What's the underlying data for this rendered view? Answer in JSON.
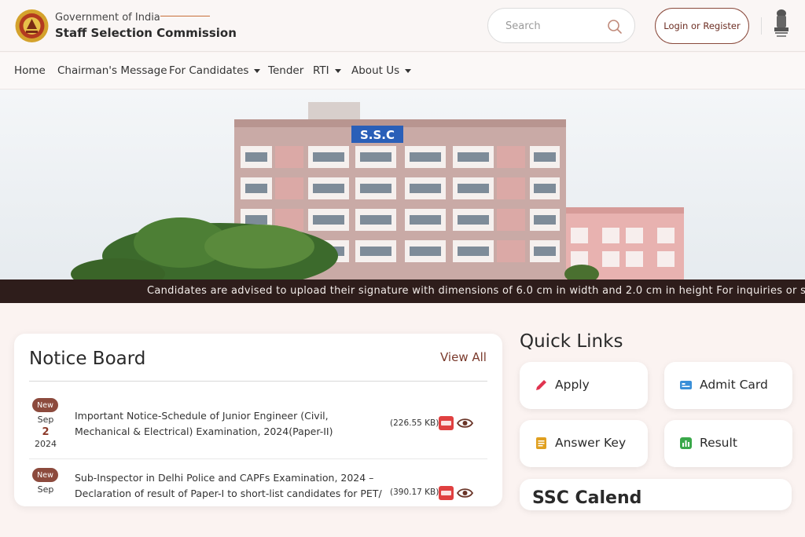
{
  "header": {
    "gov_label": "Government of India",
    "org_name": "Staff Selection Commission",
    "search_placeholder": "Search",
    "login_label": "Login or Register"
  },
  "nav": {
    "items": [
      {
        "label": "Home"
      },
      {
        "label": "Chairman's Message"
      },
      {
        "label": "For Candidates"
      },
      {
        "label": "Tender"
      },
      {
        "label": "RTI"
      },
      {
        "label": "About Us"
      }
    ]
  },
  "hero": {
    "sign_text": "S.S.C"
  },
  "marquee": {
    "text": "Candidates are advised to upload their signature with dimensions of 6.0 cm in width and 2.0 cm in height     For inquiries or s"
  },
  "notice_board": {
    "title": "Notice Board",
    "view_all": "View All",
    "notices": [
      {
        "badge": "New",
        "month": "Sep",
        "day": "2",
        "year": "2024",
        "text": "Important Notice-Schedule of Junior Engineer (Civil, Mechanical & Electrical) Examination, 2024(Paper-II)",
        "size": "(226.55 KB)"
      },
      {
        "badge": "New",
        "month": "Sep",
        "day": "",
        "year": "",
        "text": "Sub-Inspector in Delhi Police and CAPFs Examination, 2024 – Declaration of result of Paper-I to short-list candidates for PET/",
        "size": "(390.17 KB)"
      }
    ]
  },
  "quick_links": {
    "title": "Quick Links",
    "items": [
      {
        "label": "Apply",
        "icon": "pencil-icon",
        "color": "#e0334f"
      },
      {
        "label": "Admit Card",
        "icon": "id-card-icon",
        "color": "#3a8fd8"
      },
      {
        "label": "Answer Key",
        "icon": "document-icon",
        "color": "#e0a020"
      },
      {
        "label": "Result",
        "icon": "bar-chart-icon",
        "color": "#3aa84a"
      }
    ]
  },
  "ssc_calendar": {
    "title": "SSC Calend"
  },
  "colors": {
    "accent": "#8c4a3d",
    "marquee_bg": "#2e1d1b",
    "page_bg": "#fbf3f1"
  }
}
